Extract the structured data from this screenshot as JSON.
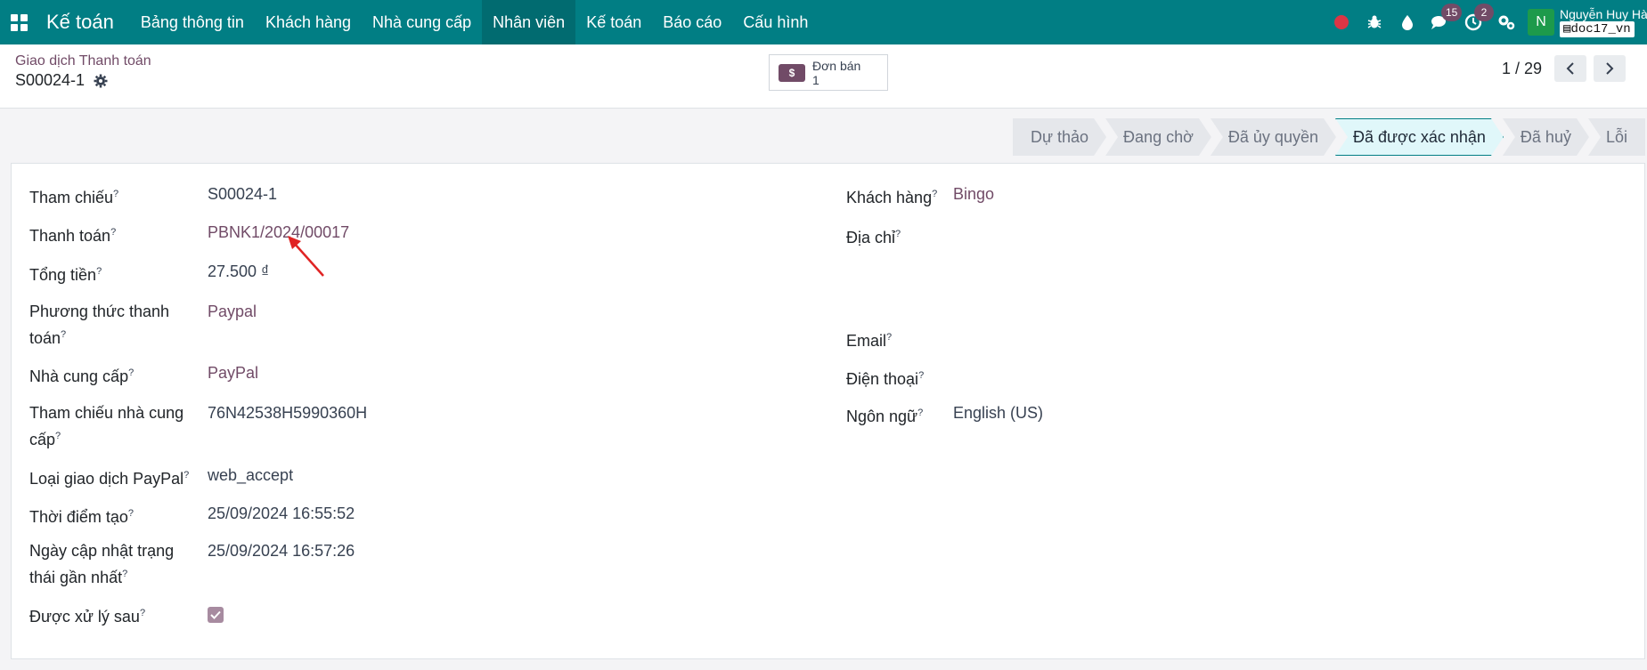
{
  "navbar": {
    "brand": "Kế toán",
    "menu": [
      "Bảng thông tin",
      "Khách hàng",
      "Nhà cung cấp",
      "Nhân viên",
      "Kế toán",
      "Báo cáo",
      "Cấu hình"
    ],
    "active_menu": "Nhân viên",
    "messages_count": "15",
    "activities_count": "2",
    "avatar_letter": "N",
    "user_name": "Nguyễn Huy Hà",
    "database": "doc17_vn"
  },
  "control_panel": {
    "breadcrumb": "Giao dịch Thanh toán",
    "record": "S00024-1",
    "smart_button": {
      "label": "Đơn bán",
      "count": "1"
    },
    "pager": "1 / 29"
  },
  "statusbar": {
    "stages": [
      "Dự thảo",
      "Đang chờ",
      "Đã ủy quyền",
      "Đã được xác nhận",
      "Đã huỷ",
      "Lỗi"
    ],
    "current": "Đã được xác nhận"
  },
  "form": {
    "left": [
      {
        "label": "Tham chiếu",
        "value": "S00024-1"
      },
      {
        "label": "Thanh toán",
        "value": "PBNK1/2024/00017"
      },
      {
        "label": "Tổng tiền",
        "value": "27.500 ₫"
      },
      {
        "label": "Phương thức thanh toán",
        "value": "Paypal"
      },
      {
        "label": "Nhà cung cấp",
        "value": "PayPal"
      },
      {
        "label": "Tham chiếu nhà cung cấp",
        "value": "76N42538H5990360H"
      },
      {
        "label": "Loại giao dịch PayPal",
        "value": "web_accept"
      },
      {
        "label": "Thời điểm tạo",
        "value": "25/09/2024 16:55:52"
      },
      {
        "label": "Ngày cập nhật trạng thái gần nhất",
        "value": "25/09/2024 16:57:26"
      },
      {
        "label": "Được xử lý sau",
        "value": ""
      }
    ],
    "right": [
      {
        "label": "Khách hàng",
        "value": "Bingo"
      },
      {
        "label": "Địa chỉ",
        "value": ""
      },
      {
        "label": "Email",
        "value": ""
      },
      {
        "label": "Điện thoại",
        "value": ""
      },
      {
        "label": "Ngôn ngữ",
        "value": "English (US)"
      }
    ],
    "tooltip_mark": "?"
  },
  "colors": {
    "navbar": "#017e84",
    "link": "#714b67",
    "active_stage": "#e0f7fa"
  }
}
